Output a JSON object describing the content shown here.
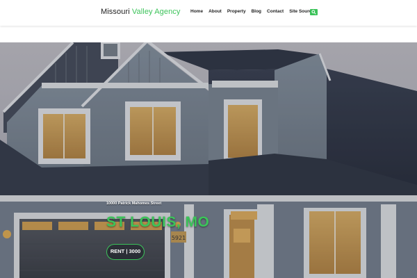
{
  "header": {
    "logo_part1": "Missouri",
    "logo_part2": "Valley Agency",
    "nav": [
      "Home",
      "About",
      "Property",
      "Blog",
      "Contact",
      "Site Source"
    ],
    "search_icon": "search-icon"
  },
  "hero": {
    "address": "10000 Patrick Mahomes Street",
    "city": "ST LOUIS, MO",
    "rent_label": "RENT | 3000",
    "house_number": "5921"
  },
  "colors": {
    "accent": "#3cc35a",
    "text": "#1d1d1d"
  }
}
